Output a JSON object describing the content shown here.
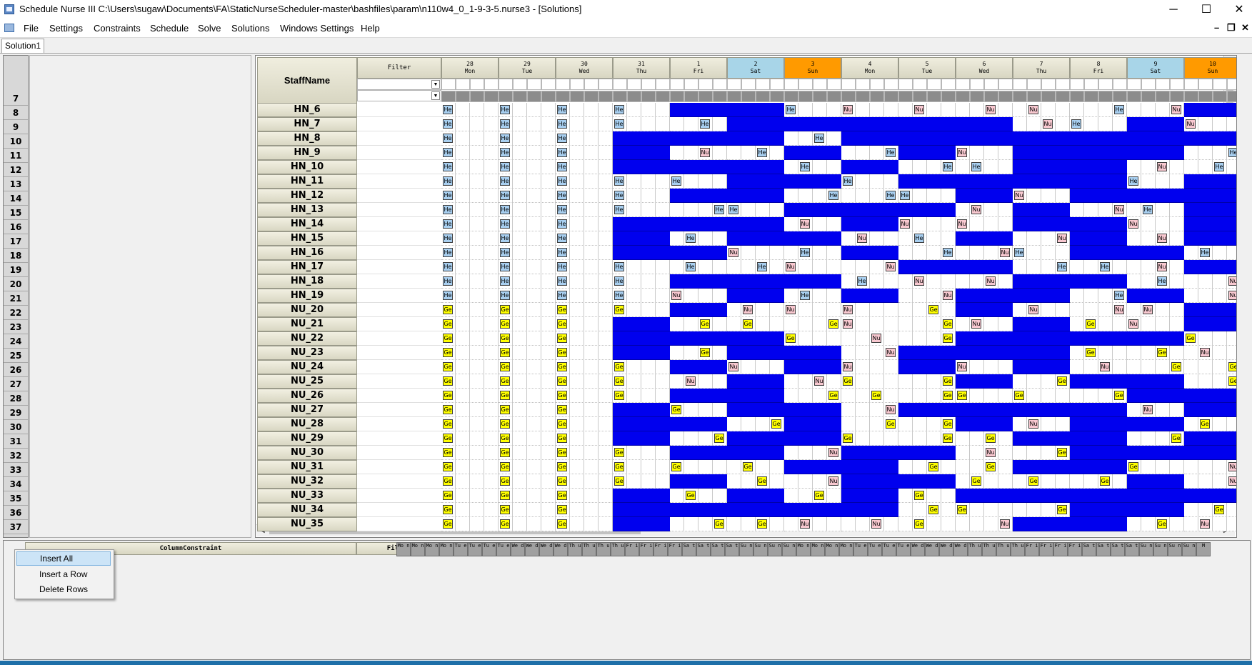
{
  "window": {
    "title": "Schedule Nurse III   C:\\Users\\sugaw\\Documents\\FA\\StaticNurseScheduler-master\\bashfiles\\param\\n110w4_0_1-9-3-5.nurse3 - [Solutions]",
    "minimize": "─",
    "maximize": "☐",
    "close": "✕"
  },
  "menu": {
    "items": [
      "File",
      "Settings",
      "Constraints",
      "Schedule",
      "Solve",
      "Solutions",
      "Windows Settings",
      "Help"
    ],
    "mdi_minimize": "–",
    "mdi_restore": "❐",
    "mdi_close": "✕"
  },
  "tabs": [
    "Solution1"
  ],
  "grid": {
    "staff_header": "StaffName",
    "filter_header": "Filter",
    "dates": [
      {
        "day": "28",
        "dow": "Mon",
        "type": "weekday"
      },
      {
        "day": "29",
        "dow": "Tue",
        "type": "weekday"
      },
      {
        "day": "30",
        "dow": "Wed",
        "type": "weekday"
      },
      {
        "day": "31",
        "dow": "Thu",
        "type": "weekday"
      },
      {
        "day": "1",
        "dow": "Fri",
        "type": "weekday"
      },
      {
        "day": "2",
        "dow": "Sat",
        "type": "sat"
      },
      {
        "day": "3",
        "dow": "Sun",
        "type": "sun"
      },
      {
        "day": "4",
        "dow": "Mon",
        "type": "weekday"
      },
      {
        "day": "5",
        "dow": "Tue",
        "type": "weekday"
      },
      {
        "day": "6",
        "dow": "Wed",
        "type": "weekday"
      },
      {
        "day": "7",
        "dow": "Thu",
        "type": "weekday"
      },
      {
        "day": "8",
        "dow": "Fri",
        "type": "weekday"
      },
      {
        "day": "9",
        "dow": "Sat",
        "type": "sat"
      },
      {
        "day": "10",
        "dow": "Sun",
        "type": "sun"
      }
    ],
    "row_numbers": [
      "7",
      "8",
      "9",
      "10",
      "11",
      "12",
      "13",
      "14",
      "15",
      "16",
      "17",
      "18",
      "19",
      "20",
      "21",
      "22",
      "23",
      "24",
      "25",
      "26",
      "27",
      "28",
      "29",
      "30",
      "31",
      "32",
      "33",
      "34",
      "35",
      "36",
      "37"
    ],
    "staff": [
      "HN_6",
      "HN_7",
      "HN_8",
      "HN_9",
      "HN_10",
      "HN_11",
      "HN_12",
      "HN_13",
      "HN_14",
      "HN_15",
      "HN_16",
      "HN_17",
      "HN_18",
      "HN_19",
      "NU_20",
      "NU_21",
      "NU_22",
      "NU_23",
      "NU_24",
      "NU_25",
      "NU_26",
      "NU_27",
      "NU_28",
      "NU_29",
      "NU_30",
      "NU_31",
      "NU_32",
      "NU_33",
      "NU_34",
      "NU_35"
    ],
    "shift_codes": {
      "head_nurse": "He",
      "nurse": "Nu",
      "general": "Ge"
    },
    "colors": {
      "block": "#0000ee",
      "he_badge": "#a8cff0",
      "nu_badge": "#f8c8d0",
      "ge_badge": "#ffff00",
      "sat": "#a8d5e8",
      "sun": "#ff9a00"
    }
  },
  "bottom": {
    "column_constraint_header": "ColumnConstraint",
    "filter_header": "Filter",
    "day_columns": [
      "Mo n",
      "Mo n",
      "Mo n",
      "Mo n",
      "Tu e",
      "Tu e",
      "Tu e",
      "Tu e",
      "We d",
      "We d",
      "We d",
      "We d",
      "Th u",
      "Th u",
      "Th u",
      "Th u",
      "Fr i",
      "Fr i",
      "Fr i",
      "Fr i",
      "Sa t",
      "Sa t",
      "Sa t",
      "Sa t",
      "Su n",
      "Su n",
      "Su n",
      "Su n",
      "Mo n",
      "Mo n",
      "Mo n",
      "Mo n",
      "Tu e",
      "Tu e",
      "Tu e",
      "Tu e",
      "We d",
      "We d",
      "We d",
      "We d",
      "Th u",
      "Th u",
      "Th u",
      "Th u",
      "Fr i",
      "Fr i",
      "Fr i",
      "Fr i",
      "Sa t",
      "Sa t",
      "Sa t",
      "Sa t",
      "Su n",
      "Su n",
      "Su n",
      "Su n",
      "M"
    ]
  },
  "context_menu": {
    "items": [
      "Insert All",
      "Insert a Row",
      "Delete Rows"
    ]
  }
}
